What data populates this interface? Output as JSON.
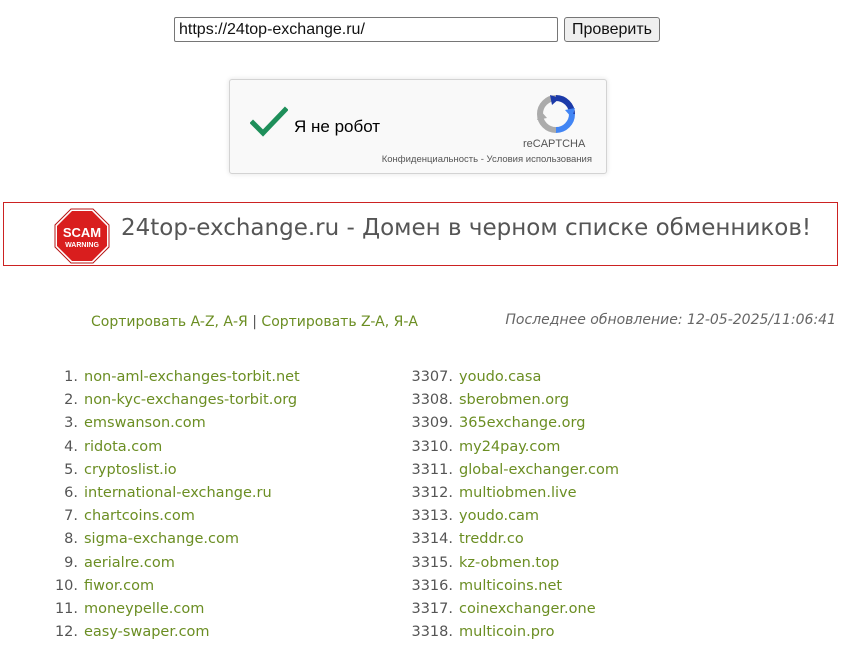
{
  "search": {
    "url_value": "https://24top-exchange.ru/",
    "button_label": "Проверить"
  },
  "captcha": {
    "label": "Я не робот",
    "brand": "reCAPTCHA",
    "privacy_link": "Конфиденциальность",
    "separator": " - ",
    "terms_link": "Условия использования"
  },
  "alert": {
    "sign_line1": "SCAM",
    "sign_line2": "WARNING",
    "message": "24top-exchange.ru - Домен в черном списке обменников!"
  },
  "sort": {
    "az_label": "Сортировать A-Z, А-Я",
    "divider": "|",
    "za_label": "Сортировать Z-A, Я-А"
  },
  "updated": {
    "text": "Последнее обновление: 12-05-2025/11:06:41"
  },
  "left_list": [
    {
      "num": "1.",
      "domain": "non-aml-exchanges-torbit.net"
    },
    {
      "num": "2.",
      "domain": "non-kyc-exchanges-torbit.org"
    },
    {
      "num": "3.",
      "domain": "emswanson.com"
    },
    {
      "num": "4.",
      "domain": "ridota.com"
    },
    {
      "num": "5.",
      "domain": "cryptoslist.io"
    },
    {
      "num": "6.",
      "domain": "international-exchange.ru"
    },
    {
      "num": "7.",
      "domain": "chartcoins.com"
    },
    {
      "num": "8.",
      "domain": "sigma-exchange.com"
    },
    {
      "num": "9.",
      "domain": "aerialre.com"
    },
    {
      "num": "10.",
      "domain": "fiwor.com"
    },
    {
      "num": "11.",
      "domain": "moneypelle.com"
    },
    {
      "num": "12.",
      "domain": "easy-swaper.com"
    }
  ],
  "right_list": [
    {
      "num": "3307.",
      "domain": "youdo.casa"
    },
    {
      "num": "3308.",
      "domain": "sberobmen.org"
    },
    {
      "num": "3309.",
      "domain": "365exchange.org"
    },
    {
      "num": "3310.",
      "domain": "my24pay.com"
    },
    {
      "num": "3311.",
      "domain": "global-exchanger.com"
    },
    {
      "num": "3312.",
      "domain": "multiobmen.live"
    },
    {
      "num": "3313.",
      "domain": "youdo.cam"
    },
    {
      "num": "3314.",
      "domain": "treddr.co"
    },
    {
      "num": "3315.",
      "domain": "kz-obmen.top"
    },
    {
      "num": "3316.",
      "domain": "multicoins.net"
    },
    {
      "num": "3317.",
      "domain": "coinexchanger.one"
    },
    {
      "num": "3318.",
      "domain": "multicoin.pro"
    }
  ],
  "colors": {
    "link": "#6b8e23",
    "alert_border": "#cc2222",
    "scam_red": "#d91e1e",
    "check_green": "#1e8f5a"
  },
  "icons": {
    "captcha_check": "checkmark-icon",
    "captcha_logo": "recaptcha-logo-icon",
    "scam_sign": "stop-sign-icon"
  }
}
